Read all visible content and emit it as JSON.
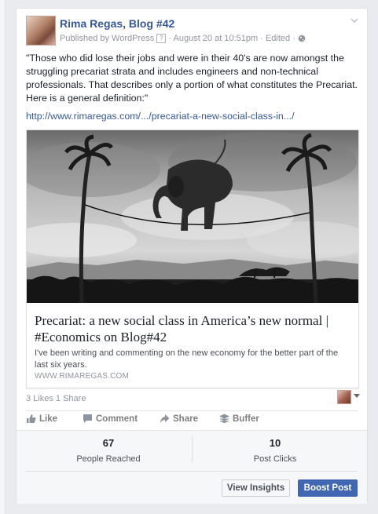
{
  "post": {
    "page_name": "Rima Regas, Blog #42",
    "meta": {
      "published_by": "Published by WordPress",
      "help": "?",
      "sep1": "·",
      "timestamp": "August 20 at 10:51pm",
      "sep2": "·",
      "edited": "Edited",
      "sep3": "·"
    },
    "text": "\"Those who did lose their jobs and were in their 40's are now amongst the struggling precariat strata and includes engineers and non-technical professionals. That describes only a portion of what constitutes the Precariat. Here is a general definition:\"",
    "link": "http://www.rimaregas.com/.../precariat-a-new-social-class-in.../"
  },
  "share": {
    "title": "Precariat: a new social class in America’s new normal | #Economics on Blog#42",
    "description": "I've been writing and commenting on the new economy for the better part of the last six years.",
    "domain": "WWW.RIMAREGAS.COM"
  },
  "stats": {
    "likes": "3 Likes",
    "shares": "1 Share"
  },
  "actions": {
    "like": "Like",
    "comment": "Comment",
    "share": "Share",
    "buffer": "Buffer"
  },
  "insights": {
    "reached_value": "67",
    "reached_label": "People Reached",
    "clicks_value": "10",
    "clicks_label": "Post Clicks",
    "view_insights": "View Insights",
    "boost_post": "Boost Post"
  },
  "colors": {
    "link": "#365899",
    "boost": "#4267b2"
  },
  "icons": [
    "chevron-down-icon",
    "help-icon",
    "globe-icon",
    "like-icon",
    "comment-icon",
    "share-icon",
    "buffer-icon"
  ]
}
